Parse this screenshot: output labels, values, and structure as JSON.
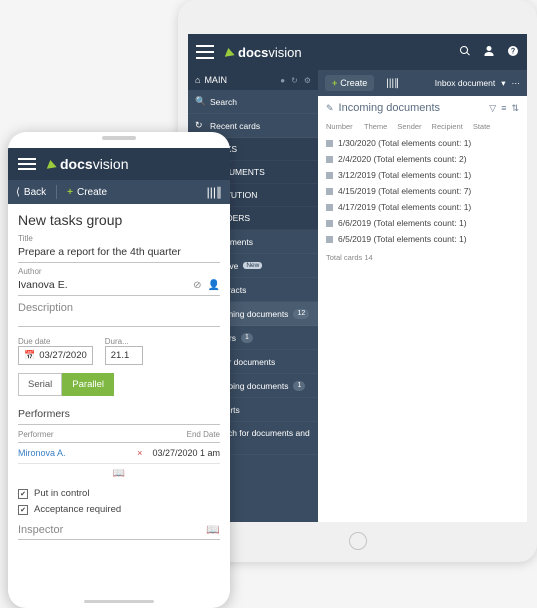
{
  "brand": {
    "name": "docsvision"
  },
  "tablet": {
    "sidebar": {
      "main": "MAIN",
      "search": "Search",
      "recent": "Recent cards",
      "sections": {
        "tasks": "MY TASKS",
        "docs": "MY DOCUMENTS",
        "sub": "SUBSTITUTION",
        "folders": "MY FOLDERS"
      },
      "folders": [
        {
          "label": "Documents",
          "badge": ""
        },
        {
          "label": "Archive",
          "badge": "New"
        },
        {
          "label": "Contracts",
          "badge": ""
        },
        {
          "label": "Incoming documents",
          "badge": "12"
        },
        {
          "label": "Orders",
          "badge": "1"
        },
        {
          "label": "Other documents",
          "badge": ""
        },
        {
          "label": "Outgoing documents",
          "badge": "1"
        },
        {
          "label": "Reports",
          "badge": ""
        },
        {
          "label": "Search for documents and tasks",
          "badge": ""
        }
      ]
    },
    "main": {
      "create": "Create",
      "inbox": "Inbox document",
      "title": "Incoming documents",
      "cols": [
        "Number",
        "Theme",
        "Sender",
        "Recipient",
        "State"
      ],
      "rows": [
        "1/30/2020 (Total elements count: 1)",
        "2/4/2020 (Total elements count: 2)",
        "3/12/2019 (Total elements count: 1)",
        "4/15/2019 (Total elements count: 7)",
        "4/17/2019 (Total elements count: 1)",
        "6/6/2019 (Total elements count: 1)",
        "6/5/2019 (Total elements count: 1)"
      ],
      "total": "Total cards 14"
    }
  },
  "phone": {
    "toolbar": {
      "back": "Back",
      "create": "Create"
    },
    "title": "New tasks group",
    "title_label": "Title",
    "title_value": "Prepare a report for the 4th quarter",
    "author_label": "Author",
    "author_value": "Ivanova E.",
    "description_label": "Description",
    "duedate_label": "Due date",
    "duedate_value": "03/27/2020",
    "duration_label": "Dura...",
    "duration_value": "21.1",
    "btn_serial": "Serial",
    "btn_parallel": "Parallel",
    "performers_label": "Performers",
    "perf_cols": [
      "Performer",
      "End Date"
    ],
    "perf_row": {
      "name": "Mironova A.",
      "date": "03/27/2020 1 am"
    },
    "check1": "Put in control",
    "check2": "Acceptance required",
    "inspector": "Inspector"
  }
}
